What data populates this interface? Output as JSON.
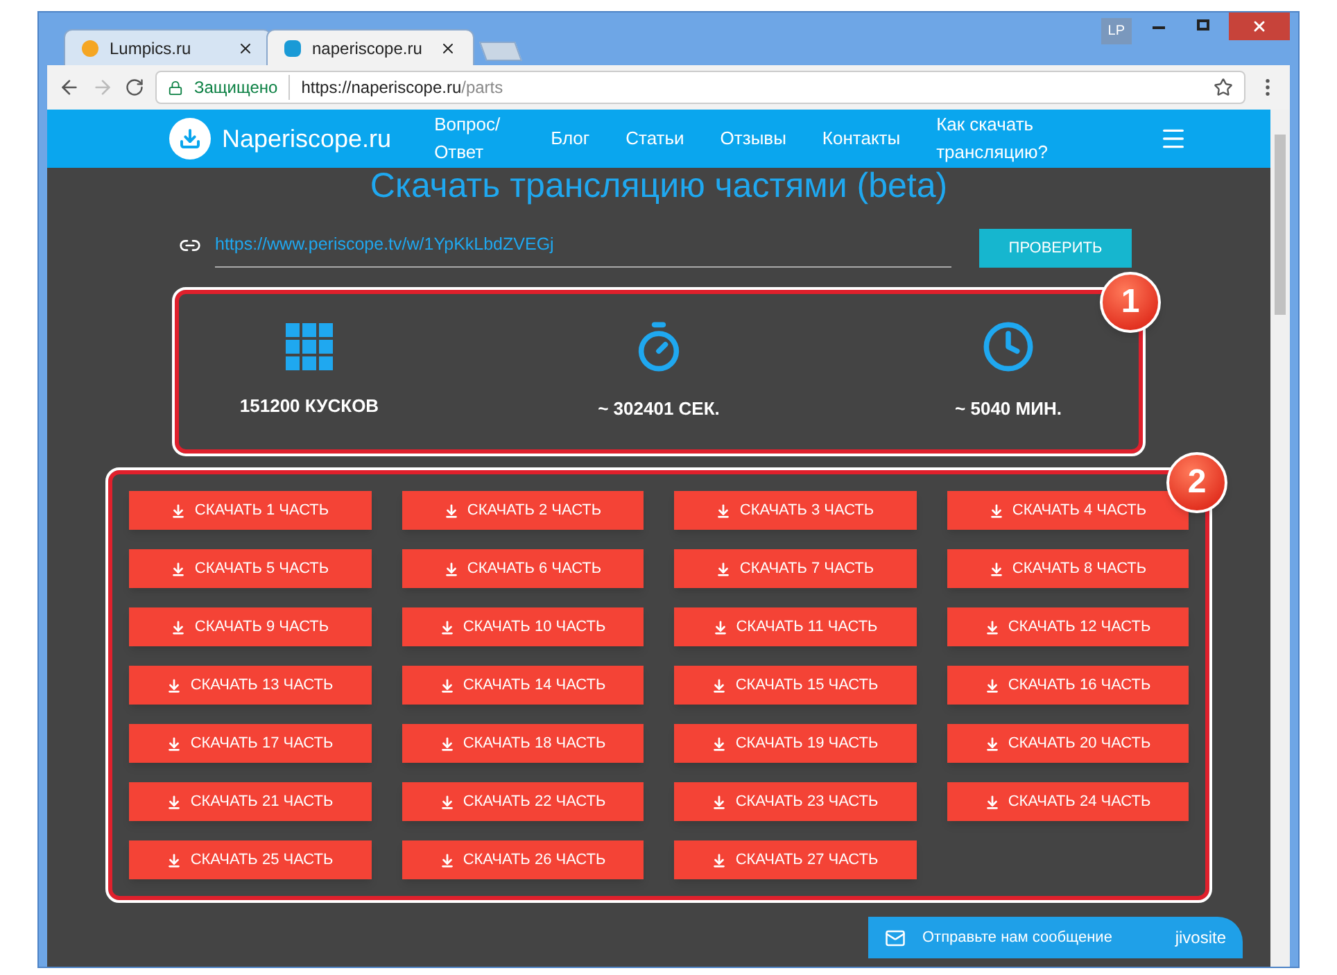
{
  "window": {
    "account_badge": "LP"
  },
  "tabs": [
    {
      "label": "Lumpics.ru",
      "selected": false
    },
    {
      "label": "naperiscope.ru",
      "selected": true
    }
  ],
  "address_bar": {
    "security_label": "Защищено",
    "url_host": "https://naperiscope.ru",
    "url_path": "/parts"
  },
  "site_nav": {
    "logo": "Naperiscope.ru",
    "links": [
      "Вопрос/ Ответ",
      "Блог",
      "Статьи",
      "Отзывы",
      "Контакты",
      "Как скачать трансляцию?"
    ]
  },
  "heading": "Скачать трансляцию частями (beta)",
  "url_field": {
    "value": "https://www.periscope.tv/w/1YpKkLbdZVEGj"
  },
  "check_button": "ПРОВЕРИТЬ",
  "stats": [
    {
      "kind": "parts",
      "text": "151200 КУСКОВ"
    },
    {
      "kind": "seconds",
      "text": "~ 302401 СЕК."
    },
    {
      "kind": "minutes",
      "text": "~ 5040 МИН."
    }
  ],
  "callouts": [
    "1",
    "2"
  ],
  "download_buttons": [
    "СКАЧАТЬ 1 ЧАСТЬ",
    "СКАЧАТЬ 2 ЧАСТЬ",
    "СКАЧАТЬ 3 ЧАСТЬ",
    "СКАЧАТЬ 4 ЧАСТЬ",
    "СКАЧАТЬ 5 ЧАСТЬ",
    "СКАЧАТЬ 6 ЧАСТЬ",
    "СКАЧАТЬ 7 ЧАСТЬ",
    "СКАЧАТЬ 8 ЧАСТЬ",
    "СКАЧАТЬ 9 ЧАСТЬ",
    "СКАЧАТЬ 10 ЧАСТЬ",
    "СКАЧАТЬ 11 ЧАСТЬ",
    "СКАЧАТЬ 12 ЧАСТЬ",
    "СКАЧАТЬ 13 ЧАСТЬ",
    "СКАЧАТЬ 14 ЧАСТЬ",
    "СКАЧАТЬ 15 ЧАСТЬ",
    "СКАЧАТЬ 16 ЧАСТЬ",
    "СКАЧАТЬ 17 ЧАСТЬ",
    "СКАЧАТЬ 18 ЧАСТЬ",
    "СКАЧАТЬ 19 ЧАСТЬ",
    "СКАЧАТЬ 20 ЧАСТЬ",
    "СКАЧАТЬ 21 ЧАСТЬ",
    "СКАЧАТЬ 22 ЧАСТЬ",
    "СКАЧАТЬ 23 ЧАСТЬ",
    "СКАЧАТЬ 24 ЧАСТЬ",
    "СКАЧАТЬ 25 ЧАСТЬ",
    "СКАЧАТЬ 26 ЧАСТЬ",
    "СКАЧАТЬ 27 ЧАСТЬ"
  ],
  "chat_widget": {
    "text": "Отправьте нам сообщение",
    "brand": "jivosite"
  }
}
